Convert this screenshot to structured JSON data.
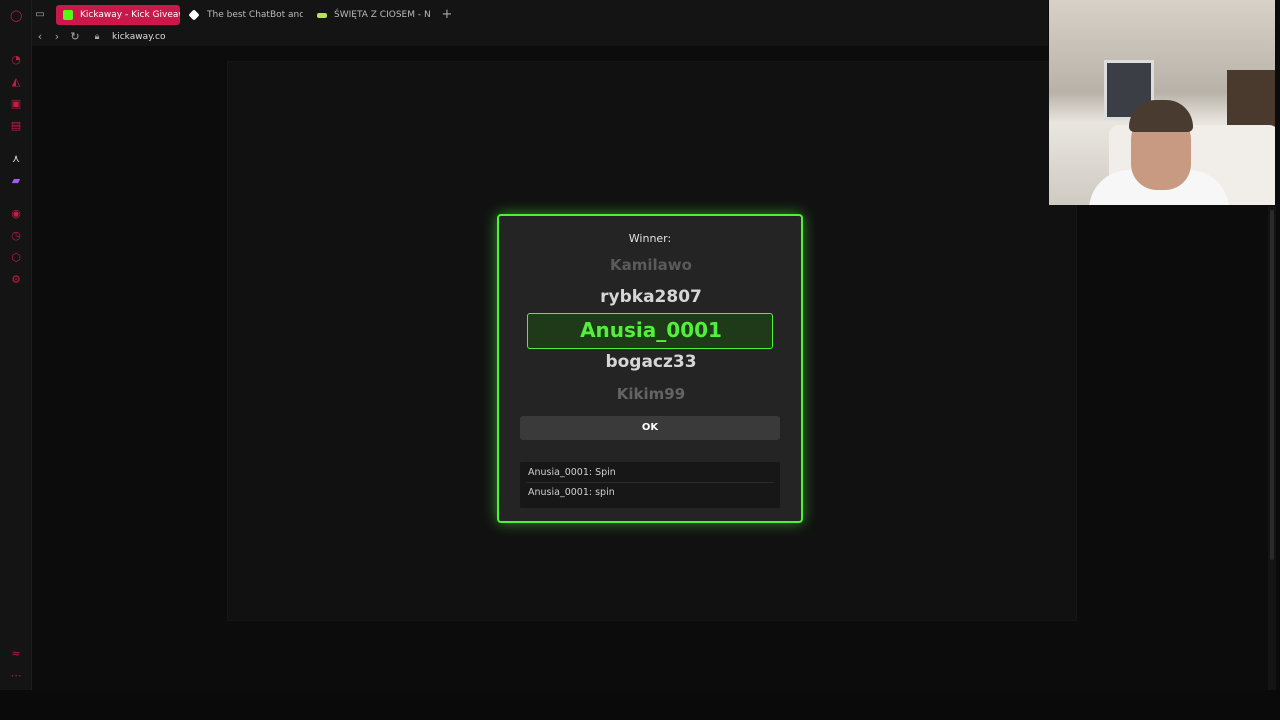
{
  "browser": {
    "tabs": [
      {
        "title": "Kickaway - Kick Giveaway",
        "active": true,
        "favicon_color": "#53fc18"
      },
      {
        "title": "The best ChatBot and Wi",
        "active": false,
        "favicon_color": "#ffffff"
      },
      {
        "title": "ŚWIĘTA Z CIOSEM - NAJ",
        "active": false,
        "favicon_color": "#b8e34a"
      }
    ],
    "new_tab_label": "+",
    "url": "kickaway.co"
  },
  "modal": {
    "title": "Winner:",
    "names": [
      "Kamilawo",
      "rybka2807",
      "Anusia_0001",
      "bogacz33",
      "Kikim99"
    ],
    "winner": "Anusia_0001",
    "ok_label": "OK",
    "log": [
      "Anusia_0001: Spin",
      "Anusia_0001: spin"
    ]
  },
  "colors": {
    "accent_green": "#52f03a",
    "brand_red": "#c8194a",
    "modal_bg": "#242424"
  }
}
